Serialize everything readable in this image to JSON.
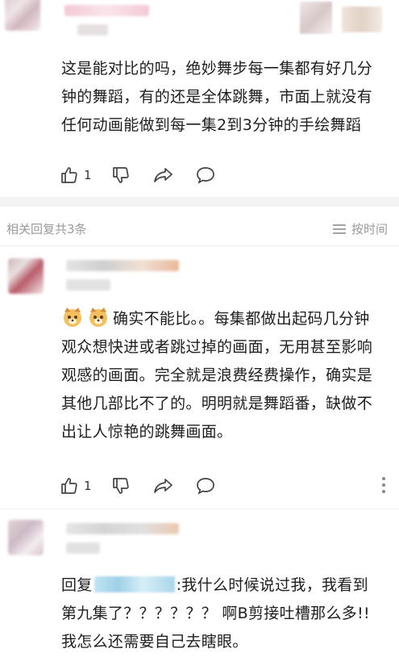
{
  "comments": [
    {
      "text": "这是能对比的吗，绝妙舞步每一集都有好几分钟的舞蹈，有的还是全体跳舞，市面上就没有任何动画能做到每一集2到3分钟的手绘舞蹈",
      "likes": "1"
    }
  ],
  "replies_header": {
    "count_label": "相关回复共3条",
    "sort_label": "按时间"
  },
  "replies": [
    {
      "text": "确实不能比。。每集都做出起码几分钟观众想快进或者跳过掉的画面，无用甚至影响观感的画面。完全就是浪费经费操作，确实是其他几部比不了的。明明就是舞蹈番，缺做不出让人惊艳的跳舞画面。",
      "likes": "1"
    },
    {
      "reply_prefix": "回复",
      "text": ":我什么时候说过我，我看到第九集了？？？？？？ 啊B剪接吐槽那么多!!我怎么还需要自己去瞎眼。"
    }
  ],
  "icons": [
    "thumb-up-icon",
    "thumb-down-icon",
    "share-icon",
    "comment-icon",
    "more-icon",
    "sort-icon",
    "dog-emoji-icon"
  ],
  "colors": {
    "divider": "#f3f3f3",
    "muted_text": "#9a9a9a",
    "redacted_name": "#a8d6ea"
  }
}
